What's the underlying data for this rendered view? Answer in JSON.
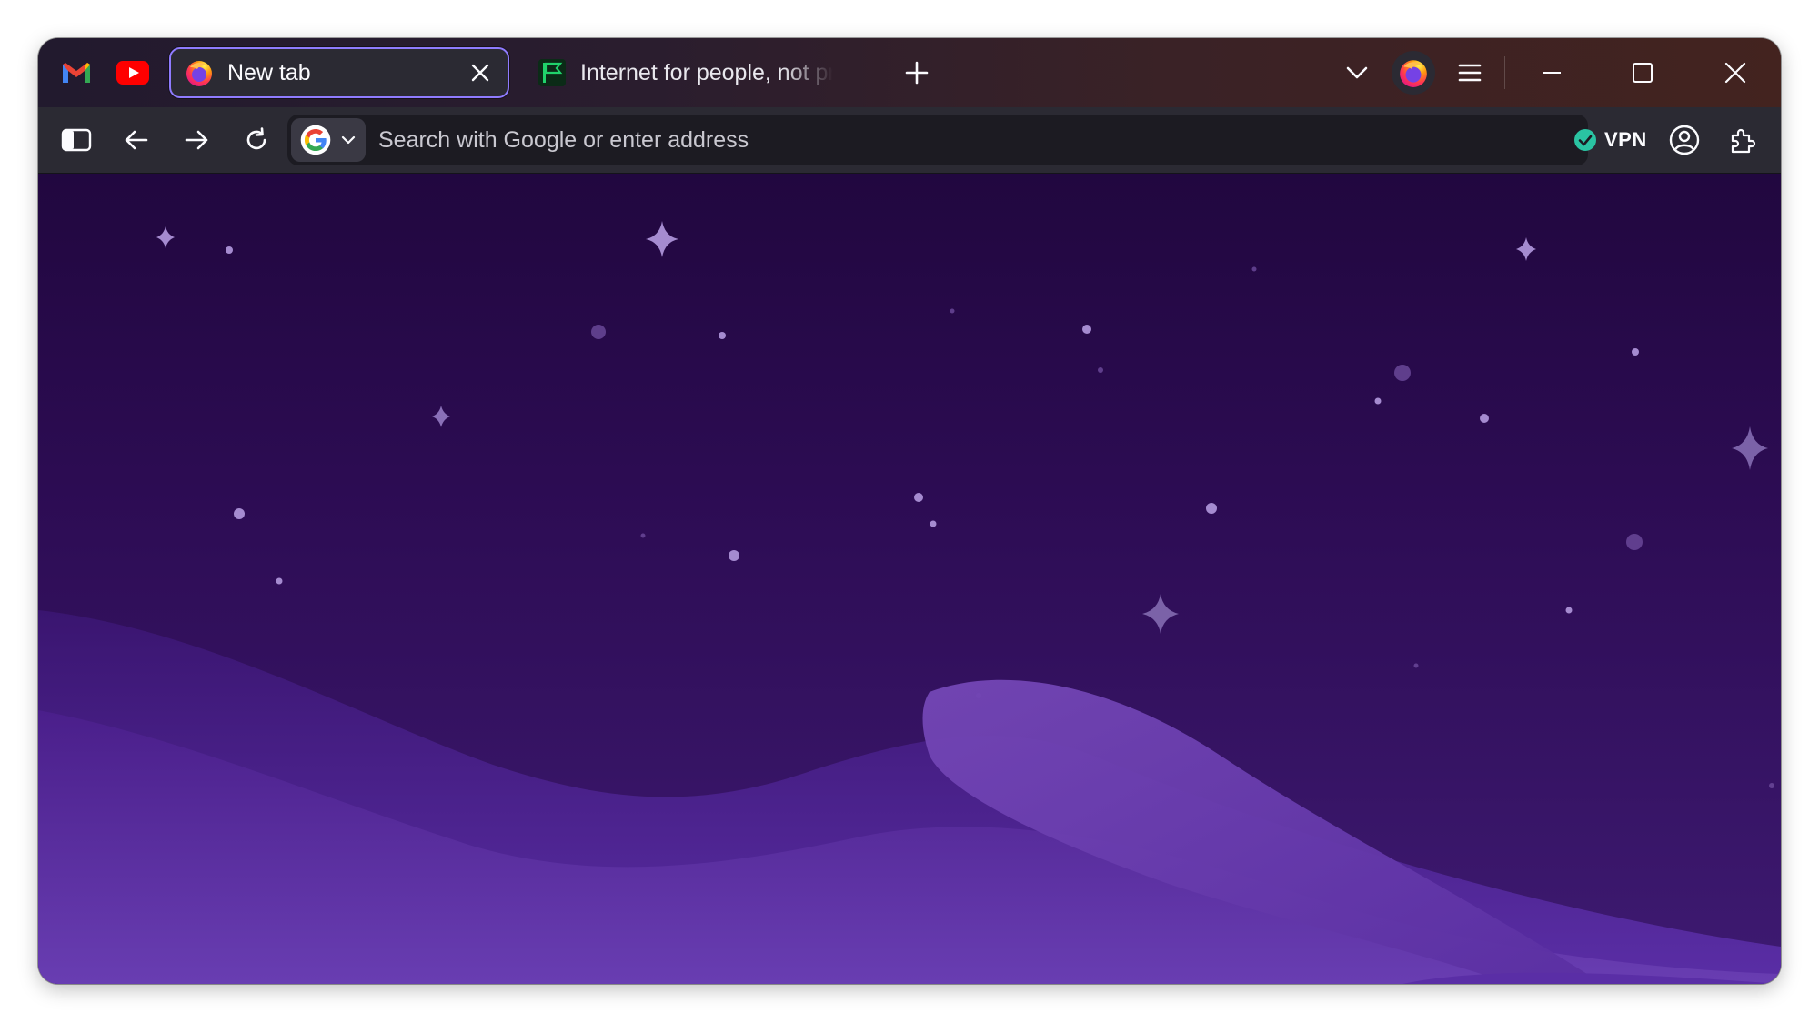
{
  "window": {
    "title": "New tab"
  },
  "pinned_tabs": [
    {
      "name": "Gmail",
      "icon": "gmail-icon"
    },
    {
      "name": "YouTube",
      "icon": "youtube-icon"
    }
  ],
  "tabs": [
    {
      "label": "New tab",
      "active": true,
      "icon": "firefox-icon"
    },
    {
      "label": "Internet for people, not profit",
      "active": false,
      "icon": "mozilla-flag-icon"
    }
  ],
  "toolbar": {
    "search_placeholder": "Search with Google or enter address",
    "search_engine_icon": "google-icon",
    "vpn_label": "VPN",
    "vpn_status": "connected"
  },
  "colors": {
    "accent": "#8f7bff",
    "vpn_connected": "#2ac3a2",
    "background_top": "#21073f",
    "background_bottom": "#6a3fb3"
  }
}
